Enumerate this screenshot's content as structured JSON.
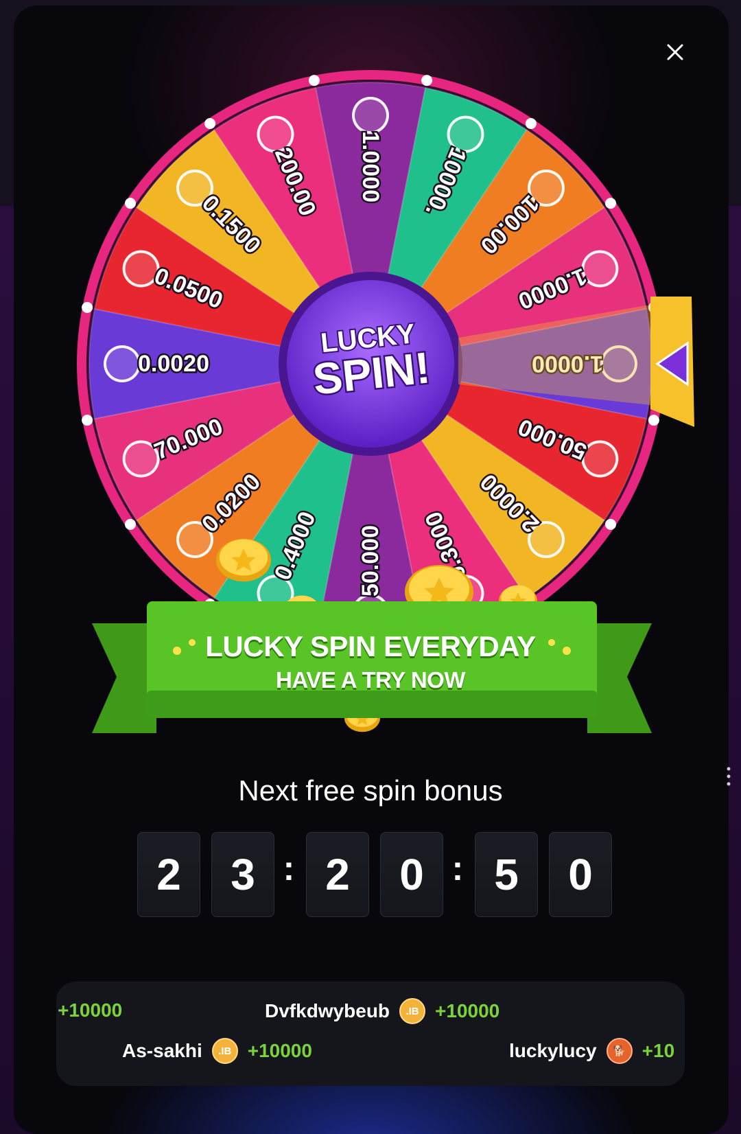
{
  "wheel": {
    "center_text_line1": "LUCKY",
    "center_text_line2": "SPIN!",
    "segments": [
      {
        "value": "1.0000",
        "coin": "bitcoin-icon",
        "color": "#8a2a9c"
      },
      {
        "value": "10000.",
        "coin": "jb-coin-icon",
        "color": "#1fc08b"
      },
      {
        "value": "100.00",
        "coin": "shiba-icon",
        "color": "#f07d22"
      },
      {
        "value": "1.0000",
        "coin": "ticket-icon",
        "color": "#e8317c"
      },
      {
        "value": "1.0000",
        "coin": "stellar-icon",
        "color": "#6a3ad6"
      },
      {
        "value": "50.000",
        "coin": "dogecoin-icon",
        "color": "#e8262f"
      },
      {
        "value": "2.0000",
        "coin": "polygon-icon",
        "color": "#f2b524"
      },
      {
        "value": "0.3000",
        "coin": "coin-icon",
        "color": "#ec2f7c"
      },
      {
        "value": "50.000",
        "coin": "tron-icon",
        "color": "#8a2a9c"
      },
      {
        "value": "0.4000",
        "coin": "chainlink-icon",
        "color": "#1fc08b"
      },
      {
        "value": "0.0200",
        "coin": "ethereum-icon",
        "color": "#f07d22"
      },
      {
        "value": "70.000",
        "coin": "uniswap-icon",
        "color": "#e8317c"
      },
      {
        "value": "0.0020",
        "coin": "bitcoin-icon",
        "color": "#6a3ad6"
      },
      {
        "value": "0.0500",
        "coin": "binance-icon",
        "color": "#e8262f"
      },
      {
        "value": "0.1500",
        "coin": "ethereum-icon",
        "color": "#f2b524"
      },
      {
        "value": "200.00",
        "coin": "xrp-icon",
        "color": "#ec2f7c"
      }
    ]
  },
  "banner": {
    "line1": "LUCKY SPIN EVERYDAY",
    "line2": "HAVE A TRY NOW"
  },
  "next_spin": {
    "label": "Next free spin bonus",
    "digits": [
      "2",
      "3",
      "2",
      "0",
      "5",
      "0"
    ],
    "separator": ":"
  },
  "ticker": {
    "row1": [
      {
        "name": "",
        "coin": "jb",
        "amount": "+10000"
      },
      {
        "name": "Dvfkdwybeub",
        "coin": "jb",
        "amount": "+10000"
      }
    ],
    "row2": [
      {
        "name": "As-sakhi",
        "coin": "jb",
        "amount": "+10000"
      },
      {
        "name": "luckylucy",
        "coin": "shib",
        "amount": "+10"
      }
    ],
    "coin_labels": {
      "jb": ".IB",
      "shib": "🐕"
    }
  },
  "colors": {
    "rim": "#e6267f",
    "banner_green": "#4fb71f",
    "amount_green": "#7bd33a",
    "pointer_yellow": "#f6c12a",
    "pointer_purple": "#7a2fd8"
  }
}
